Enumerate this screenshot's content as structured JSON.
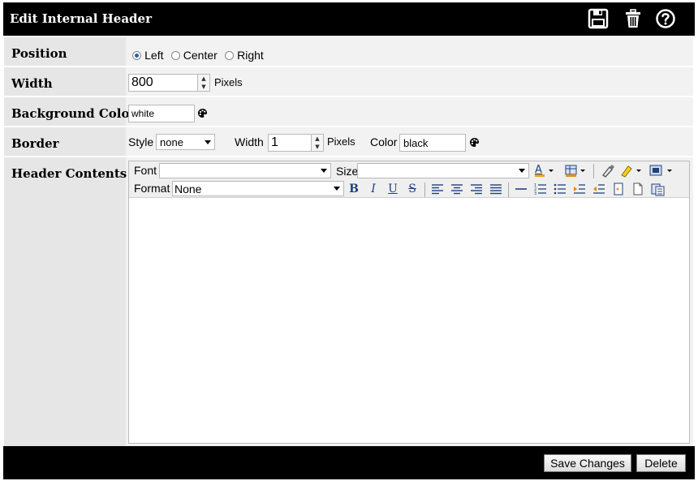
{
  "window": {
    "title": "Edit Internal Header"
  },
  "titlebar": {
    "icons": [
      "save-icon",
      "trash-icon",
      "help-icon"
    ]
  },
  "position": {
    "label": "Position",
    "options": [
      {
        "label": "Left",
        "selected": true
      },
      {
        "label": "Center",
        "selected": false
      },
      {
        "label": "Right",
        "selected": false
      }
    ]
  },
  "width": {
    "label": "Width",
    "value": "800",
    "unit": "Pixels"
  },
  "background": {
    "label": "Background Color",
    "value": "white",
    "icon": "palette-icon"
  },
  "border": {
    "label": "Border",
    "style_label": "Style",
    "style_value": "none",
    "width_label": "Width",
    "width_value": "1",
    "unit": "Pixels",
    "color_label": "Color",
    "color_value": "black",
    "icon": "palette-icon"
  },
  "header_contents": {
    "label": "Header Contents",
    "toolbar": {
      "font_label": "Font",
      "font_value": "",
      "size_label": "Size",
      "size_value": "",
      "format_label": "Format",
      "format_value": "None",
      "bold": "B",
      "italic": "I",
      "underline": "U",
      "strike": "S"
    }
  },
  "footer": {
    "save_label": "Save Changes",
    "delete_label": "Delete"
  },
  "colors": {
    "frame": "#000000",
    "label_bg": "#e6e6e6",
    "value_bg": "#f2f2f2",
    "toolbar_icon": "#23407c"
  }
}
